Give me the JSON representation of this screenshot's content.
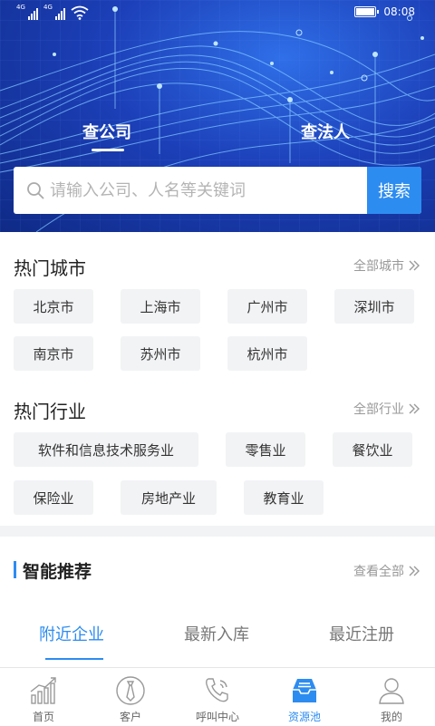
{
  "status_bar": {
    "signal_tags": [
      "4G",
      "4G"
    ],
    "time": "08:08"
  },
  "search": {
    "tabs": [
      {
        "label": "查公司",
        "active": true
      },
      {
        "label": "查法人",
        "active": false
      }
    ],
    "placeholder": "请输入公司、人名等关键词",
    "button_label": "搜索"
  },
  "hot_cities": {
    "title": "热门城市",
    "more_label": "全部城市",
    "items": [
      "北京市",
      "上海市",
      "广州市",
      "深圳市",
      "南京市",
      "苏州市",
      "杭州市"
    ]
  },
  "hot_industries": {
    "title": "热门行业",
    "more_label": "全部行业",
    "items": [
      "软件和信息技术服务业",
      "零售业",
      "餐饮业",
      "保险业",
      "房地产业",
      "教育业"
    ]
  },
  "recommend": {
    "title": "智能推荐",
    "more_label": "查看全部",
    "tabs": [
      {
        "label": "附近企业",
        "active": true
      },
      {
        "label": "最新入库",
        "active": false
      },
      {
        "label": "最近注册",
        "active": false
      }
    ]
  },
  "tabbar": {
    "items": [
      {
        "label": "首页",
        "icon": "chart-icon",
        "active": false
      },
      {
        "label": "客户",
        "icon": "tie-icon",
        "active": false
      },
      {
        "label": "呼叫中心",
        "icon": "phone-icon",
        "active": false
      },
      {
        "label": "资源池",
        "icon": "inbox-icon",
        "active": true
      },
      {
        "label": "我的",
        "icon": "user-icon",
        "active": false
      }
    ]
  },
  "colors": {
    "accent": "#2d8cf0",
    "hero_dark": "#0f2a86",
    "chip_bg": "#f2f3f5"
  }
}
